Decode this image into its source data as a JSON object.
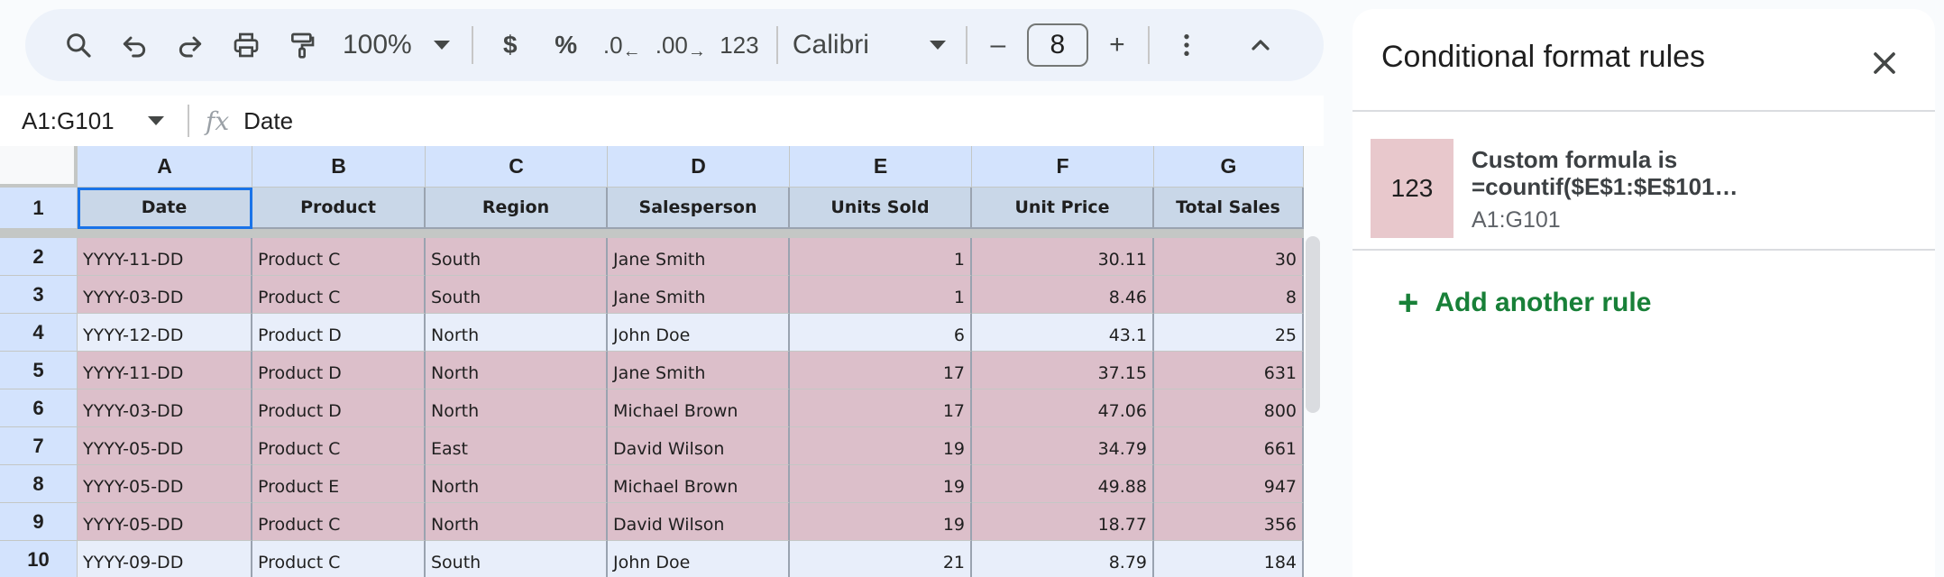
{
  "toolbar": {
    "zoom": "100%",
    "currency_symbol": "$",
    "percent_symbol": "%",
    "decrease_decimal": ".0",
    "increase_decimal": ".00",
    "number_format": "123",
    "font": "Calibri",
    "font_size": "8",
    "minus": "–",
    "plus": "+"
  },
  "formula_bar": {
    "name_box": "A1:G101",
    "fx": "fx",
    "content": "Date"
  },
  "grid": {
    "columns": [
      "A",
      "B",
      "C",
      "D",
      "E",
      "F",
      "G"
    ],
    "header_row": {
      "row_num": "1",
      "cells": [
        "Date",
        "Product",
        "Region",
        "Salesperson",
        "Units Sold",
        "Unit Price",
        "Total Sales"
      ]
    },
    "rows": [
      {
        "row_num": "2",
        "highlight": "pink",
        "cells": [
          "YYYY-11-DD",
          "Product C",
          "South",
          "Jane Smith",
          "1",
          "30.11",
          "30"
        ]
      },
      {
        "row_num": "3",
        "highlight": "pink",
        "cells": [
          "YYYY-03-DD",
          "Product C",
          "South",
          "Jane Smith",
          "1",
          "8.46",
          "8"
        ]
      },
      {
        "row_num": "4",
        "highlight": "blue",
        "cells": [
          "YYYY-12-DD",
          "Product D",
          "North",
          "John Doe",
          "6",
          "43.1",
          "25"
        ]
      },
      {
        "row_num": "5",
        "highlight": "pink",
        "cells": [
          "YYYY-11-DD",
          "Product D",
          "North",
          "Jane Smith",
          "17",
          "37.15",
          "631"
        ]
      },
      {
        "row_num": "6",
        "highlight": "pink",
        "cells": [
          "YYYY-03-DD",
          "Product D",
          "North",
          "Michael Brown",
          "17",
          "47.06",
          "800"
        ]
      },
      {
        "row_num": "7",
        "highlight": "pink",
        "cells": [
          "YYYY-05-DD",
          "Product C",
          "East",
          "David Wilson",
          "19",
          "34.79",
          "661"
        ]
      },
      {
        "row_num": "8",
        "highlight": "pink",
        "cells": [
          "YYYY-05-DD",
          "Product E",
          "North",
          "Michael Brown",
          "19",
          "49.88",
          "947"
        ]
      },
      {
        "row_num": "9",
        "highlight": "pink",
        "cells": [
          "YYYY-05-DD",
          "Product C",
          "North",
          "David Wilson",
          "19",
          "18.77",
          "356"
        ]
      },
      {
        "row_num": "10",
        "highlight": "blue",
        "cells": [
          "YYYY-09-DD",
          "Product C",
          "South",
          "John Doe",
          "21",
          "8.79",
          "184"
        ]
      }
    ]
  },
  "panel": {
    "title": "Conditional format rules",
    "rule": {
      "swatch_text": "123",
      "line1": "Custom formula is",
      "line2": "=countif($E$1:$E$101…",
      "range": "A1:G101"
    },
    "add_rule_label": "Add another rule"
  },
  "colors": {
    "highlight_pink": "#dcbfca",
    "highlight_blue": "#e8eefa",
    "accent_green": "#188038",
    "selection_blue": "#1a73e8"
  },
  "icons": [
    "search-icon",
    "undo-icon",
    "redo-icon",
    "print-icon",
    "paint-format-icon",
    "more-vert-icon",
    "chevron-up-icon",
    "close-icon",
    "plus-icon"
  ]
}
